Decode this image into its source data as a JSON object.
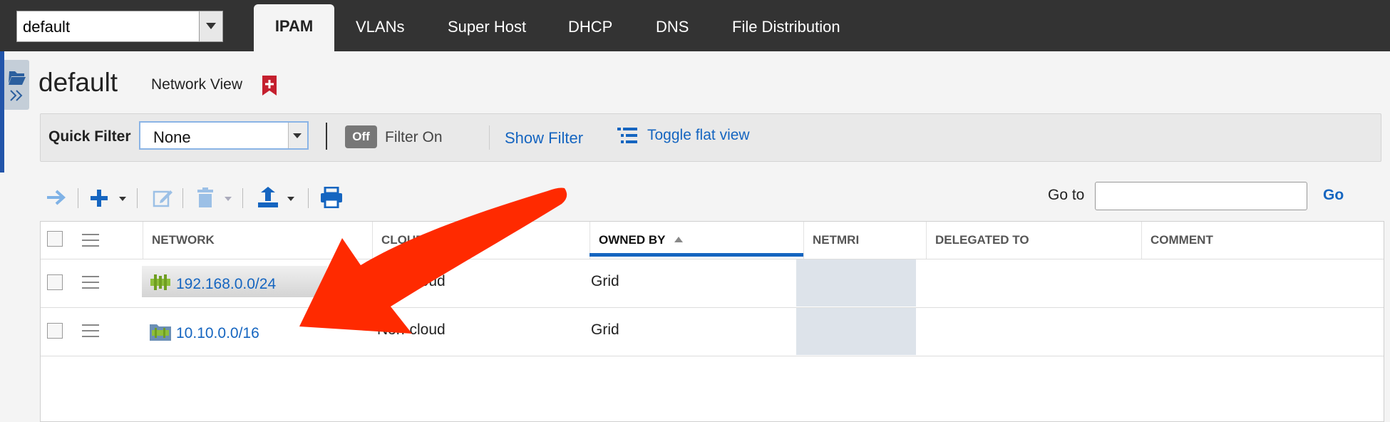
{
  "header": {
    "view_selector_value": "default",
    "tabs": [
      {
        "label": "IPAM",
        "active": true
      },
      {
        "label": "VLANs"
      },
      {
        "label": "Super Host"
      },
      {
        "label": "DHCP"
      },
      {
        "label": "DNS"
      },
      {
        "label": "File Distribution"
      }
    ]
  },
  "page": {
    "title": "default",
    "subtitle": "Network View"
  },
  "filter": {
    "quick_filter_label": "Quick Filter",
    "quick_filter_value": "None",
    "toggle_label": "Off",
    "filter_on_label": "Filter On",
    "show_filter": "Show Filter",
    "toggle_flat_view": "Toggle flat view"
  },
  "toolbar": {
    "goto_label": "Go to",
    "goto_value": "",
    "go_button": "Go"
  },
  "table": {
    "columns": [
      "NETWORK",
      "CLOUD USAGE",
      "OWNED BY",
      "NETMRI",
      "DELEGATED TO",
      "COMMENT"
    ],
    "sorted_column": "OWNED BY",
    "rows": [
      {
        "network": "192.168.0.0/24",
        "cloud_usage": "Non-cloud",
        "owned_by": "Grid",
        "netmri": "",
        "delegated_to": "",
        "comment": ""
      },
      {
        "network": "10.10.0.0/16",
        "cloud_usage": "Non-cloud",
        "owned_by": "Grid",
        "netmri": "",
        "delegated_to": "",
        "comment": ""
      }
    ]
  },
  "colors": {
    "topbar": "#333333",
    "link": "#1565c0",
    "annotation_arrow": "#ff2a00"
  }
}
